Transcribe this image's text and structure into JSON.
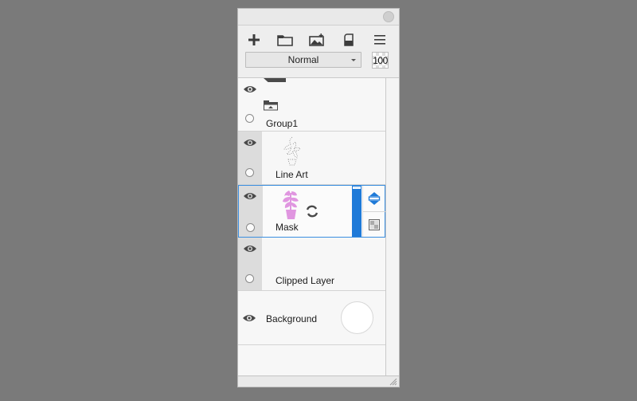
{
  "panel": {
    "toolbar": {
      "tools": [
        {
          "icon": "plus-icon",
          "label": "New layer"
        },
        {
          "icon": "folder-icon",
          "label": "New folder"
        },
        {
          "icon": "add-image-icon",
          "label": "Add image"
        },
        {
          "icon": "mask-icon",
          "label": "Mask"
        },
        {
          "icon": "menu-icon",
          "label": "Menu"
        }
      ],
      "blend_mode": "Normal",
      "opacity": "100"
    },
    "layers": [
      {
        "name": "Group1",
        "type": "group",
        "visible": true
      },
      {
        "name": "Line Art",
        "type": "clipped",
        "visible": true
      },
      {
        "name": "Mask",
        "type": "clipped",
        "visible": true,
        "selected": true,
        "thumbnail_color": "#e096e0"
      },
      {
        "name": "Clipped Layer",
        "type": "clipped",
        "visible": true
      },
      {
        "name": "Background",
        "type": "background",
        "visible": true
      }
    ],
    "colors": {
      "accent": "#1f7ad8",
      "mask_tint": "#e096e0"
    }
  }
}
